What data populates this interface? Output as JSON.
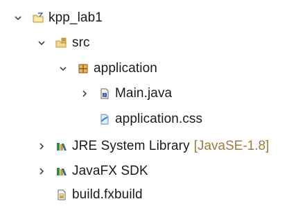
{
  "tree": {
    "project": {
      "label": "kpp_lab1",
      "icon": "java-project-folder-icon",
      "toggle": "expanded"
    },
    "src": {
      "label": "src",
      "icon": "source-folder-icon",
      "toggle": "expanded"
    },
    "package": {
      "label": "application",
      "icon": "package-icon",
      "toggle": "expanded"
    },
    "main_java": {
      "label": "Main.java",
      "icon": "java-file-icon",
      "toggle": "collapsed"
    },
    "app_css": {
      "label": "application.css",
      "icon": "css-file-icon",
      "toggle": "none"
    },
    "jre": {
      "label": "JRE System Library",
      "decoration": "[JavaSE-1.8]",
      "icon": "library-icon",
      "toggle": "collapsed"
    },
    "javafx": {
      "label": "JavaFX SDK",
      "icon": "library-icon",
      "toggle": "collapsed"
    },
    "fxbuild": {
      "label": "build.fxbuild",
      "icon": "fxbuild-file-icon",
      "toggle": "none"
    }
  },
  "glyphs": {
    "expanded": "⌄",
    "collapsed": "›"
  },
  "colors": {
    "decoration": "#a07a3a",
    "text": "#1a1a1a",
    "toggle": "#444444"
  }
}
